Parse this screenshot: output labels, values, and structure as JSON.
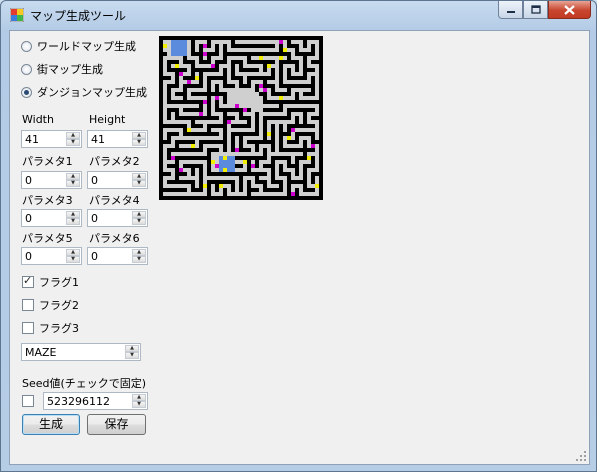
{
  "window": {
    "title": "マップ生成ツール",
    "minimize_icon": "minimize-icon",
    "maximize_icon": "maximize-icon",
    "close_icon": "close-icon"
  },
  "map_type": {
    "options": [
      {
        "label": "ワールドマップ生成",
        "checked": false
      },
      {
        "label": "街マップ生成",
        "checked": false
      },
      {
        "label": "ダンジョンマップ生成",
        "checked": true
      }
    ]
  },
  "size": {
    "width_label": "Width",
    "width_value": "41",
    "height_label": "Height",
    "height_value": "41"
  },
  "params": [
    {
      "label": "パラメタ1",
      "value": "0"
    },
    {
      "label": "パラメタ2",
      "value": "0"
    },
    {
      "label": "パラメタ3",
      "value": "0"
    },
    {
      "label": "パラメタ4",
      "value": "0"
    },
    {
      "label": "パラメタ5",
      "value": "0"
    },
    {
      "label": "パラメタ6",
      "value": "0"
    }
  ],
  "flags": [
    {
      "label": "フラグ1",
      "checked": true
    },
    {
      "label": "フラグ2",
      "checked": false
    },
    {
      "label": "フラグ3",
      "checked": false
    }
  ],
  "algorithm": {
    "selected": "MAZE"
  },
  "seed": {
    "label": "Seed値(チェックで固定)",
    "fixed": false,
    "value": "523296112"
  },
  "buttons": {
    "generate": "生成",
    "save": "保存"
  },
  "maze_colors": {
    "floor": "#cfcfcf",
    "wall": "#000000",
    "magenta": "#cc00cc",
    "yellow": "#f2ee00",
    "blue": "#5b8bdc"
  }
}
